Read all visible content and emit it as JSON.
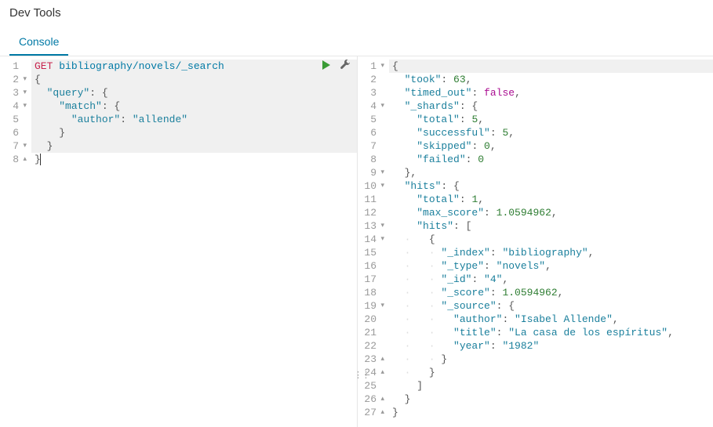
{
  "header": {
    "title": "Dev Tools"
  },
  "tabs": {
    "console": "Console"
  },
  "request": {
    "method": "GET",
    "path": "bibliography/novels/_search",
    "lines": [
      {
        "n": 1,
        "fold": "",
        "hl": true
      },
      {
        "n": 2,
        "fold": "▾",
        "hl": true
      },
      {
        "n": 3,
        "fold": "▾",
        "hl": true
      },
      {
        "n": 4,
        "fold": "▾",
        "hl": true
      },
      {
        "n": 5,
        "fold": "",
        "hl": true
      },
      {
        "n": 6,
        "fold": "",
        "hl": true
      },
      {
        "n": 7,
        "fold": "▾",
        "hl": true
      },
      {
        "n": 8,
        "fold": "▴",
        "hl": false
      }
    ],
    "body": {
      "query_key": "\"query\"",
      "match_key": "\"match\"",
      "author_key": "\"author\"",
      "author_val": "\"allende\""
    }
  },
  "response": {
    "lines": [
      {
        "n": 1,
        "fold": "▾"
      },
      {
        "n": 2,
        "fold": ""
      },
      {
        "n": 3,
        "fold": ""
      },
      {
        "n": 4,
        "fold": "▾"
      },
      {
        "n": 5,
        "fold": ""
      },
      {
        "n": 6,
        "fold": ""
      },
      {
        "n": 7,
        "fold": ""
      },
      {
        "n": 8,
        "fold": ""
      },
      {
        "n": 9,
        "fold": "▾"
      },
      {
        "n": 10,
        "fold": "▾"
      },
      {
        "n": 11,
        "fold": ""
      },
      {
        "n": 12,
        "fold": ""
      },
      {
        "n": 13,
        "fold": "▾"
      },
      {
        "n": 14,
        "fold": "▾"
      },
      {
        "n": 15,
        "fold": ""
      },
      {
        "n": 16,
        "fold": ""
      },
      {
        "n": 17,
        "fold": ""
      },
      {
        "n": 18,
        "fold": ""
      },
      {
        "n": 19,
        "fold": "▾"
      },
      {
        "n": 20,
        "fold": ""
      },
      {
        "n": 21,
        "fold": ""
      },
      {
        "n": 22,
        "fold": ""
      },
      {
        "n": 23,
        "fold": "▴"
      },
      {
        "n": 24,
        "fold": "▴"
      },
      {
        "n": 25,
        "fold": ""
      },
      {
        "n": 26,
        "fold": "▴"
      },
      {
        "n": 27,
        "fold": "▴"
      }
    ],
    "k": {
      "took": "\"took\"",
      "timed_out": "\"timed_out\"",
      "shards": "\"_shards\"",
      "total": "\"total\"",
      "successful": "\"successful\"",
      "skipped": "\"skipped\"",
      "failed": "\"failed\"",
      "hits": "\"hits\"",
      "max_score": "\"max_score\"",
      "index": "\"_index\"",
      "type": "\"_type\"",
      "id": "\"_id\"",
      "score": "\"_score\"",
      "source": "\"_source\"",
      "author": "\"author\"",
      "title": "\"title\"",
      "year": "\"year\""
    },
    "v": {
      "took": "63",
      "timed_out": "false",
      "shards_total": "5",
      "successful": "5",
      "skipped": "0",
      "failed": "0",
      "hits_total": "1",
      "max_score": "1.0594962",
      "index": "\"bibliography\"",
      "type": "\"novels\"",
      "id": "\"4\"",
      "score": "1.0594962",
      "author": "\"Isabel Allende\"",
      "title": "\"La casa de los espíritus\"",
      "year": "\"1982\""
    }
  }
}
